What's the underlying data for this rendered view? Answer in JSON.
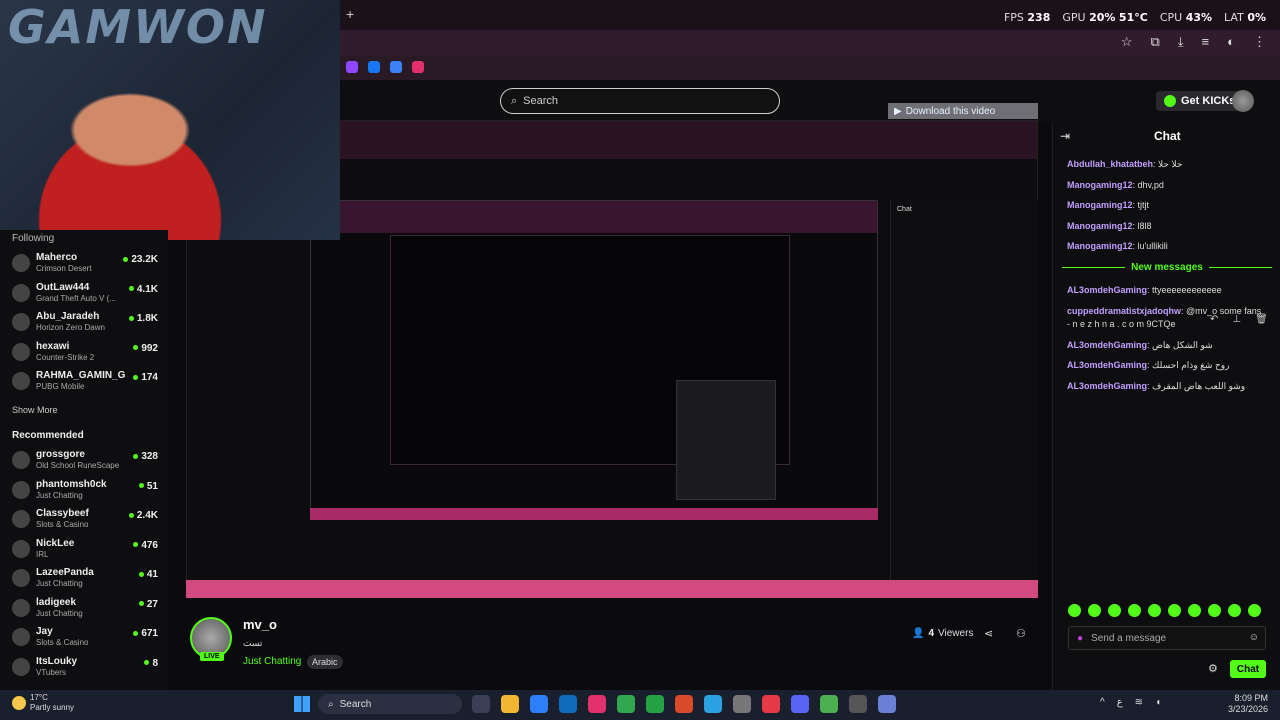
{
  "webcam": {
    "logo_text": "GAMWON"
  },
  "browser": {
    "new_tab": "+",
    "perf": {
      "fps_label": "FPS",
      "fps_value": "238",
      "gpu_label": "GPU",
      "gpu_value": "20%",
      "gpu_temp": "51°C",
      "cpu_label": "CPU",
      "cpu_value": "43%",
      "lat_label": "LAT",
      "lat_value": "0%"
    },
    "download_banner": "Download this video"
  },
  "header": {
    "search_placeholder": "Search",
    "get_kicks": "Get KICKs"
  },
  "sidebar": {
    "following_label": "Following",
    "following": [
      {
        "name": "Maherco",
        "game": "Crimson Desert",
        "viewers": "23.2K"
      },
      {
        "name": "OutLaw444",
        "game": "Grand Theft Auto V (...",
        "viewers": "4.1K"
      },
      {
        "name": "Abu_Jaradeh",
        "game": "Horizon Zero Dawn",
        "viewers": "1.8K"
      },
      {
        "name": "hexawi",
        "game": "Counter-Strike 2",
        "viewers": "992"
      },
      {
        "name": "RAHMA_GAMIN_G",
        "game": "PUBG Mobile",
        "viewers": "174"
      }
    ],
    "show_more": "Show More",
    "recommended_label": "Recommended",
    "recommended": [
      {
        "name": "grossgore",
        "game": "Old School RuneScape",
        "viewers": "328"
      },
      {
        "name": "phantomsh0ck",
        "game": "Just Chatting",
        "viewers": "51"
      },
      {
        "name": "Classybeef",
        "game": "Slots & Casino",
        "viewers": "2.4K"
      },
      {
        "name": "NickLee",
        "game": "IRL",
        "viewers": "476"
      },
      {
        "name": "LazeePanda",
        "game": "Just Chatting",
        "viewers": "41"
      },
      {
        "name": "ladigeek",
        "game": "Just Chatting",
        "viewers": "27"
      },
      {
        "name": "Jay",
        "game": "Slots & Casino",
        "viewers": "671"
      },
      {
        "name": "ItsLouky",
        "game": "VTubers",
        "viewers": "8"
      }
    ]
  },
  "stream": {
    "streamer": "mv_o",
    "title": "تست",
    "category": "Just Chatting",
    "language": "Arabic",
    "live": "LIVE",
    "viewers_count": "4",
    "viewers_label": "Viewers"
  },
  "chat": {
    "title": "Chat",
    "messages_before": [
      {
        "user": "Abdullah_khatatbeh",
        "text": "حلا حلا"
      },
      {
        "user": "Manogaming12",
        "text": "dhv,pd"
      },
      {
        "user": "Manogaming12",
        "text": "tjtjt"
      },
      {
        "user": "Manogaming12",
        "text": "l8l8"
      },
      {
        "user": "Manogaming12",
        "text": "lu'ullikili"
      }
    ],
    "new_messages": "New messages",
    "messages_after": [
      {
        "user": "AL3omdehGaming",
        "text": "ttyeeeeeeeeeeee"
      },
      {
        "user": "cuppeddramatistxjadoqhw",
        "text": "@mv_o some fans"
      },
      {
        "user": "",
        "text": "- n e z h n a . c o m 9CTQe"
      },
      {
        "user": "AL3omdehGaming",
        "text": "شو الشكل هاض"
      },
      {
        "user": "AL3omdehGaming",
        "text": "روح شغ وذام احسلك"
      },
      {
        "user": "AL3omdehGaming",
        "text": "وشو اللعب هاض المقرف"
      }
    ],
    "input_placeholder": "Send a message",
    "send_button": "Chat"
  },
  "taskbar": {
    "weather_temp": "17°C",
    "weather_desc": "Partly sunny",
    "search": "Search",
    "time": "8:09 PM",
    "date": "3/23/2026"
  },
  "colors": {
    "kick_green": "#53fc18",
    "chat_user": "#c39eff",
    "taskbar": "#1a1f2e"
  }
}
